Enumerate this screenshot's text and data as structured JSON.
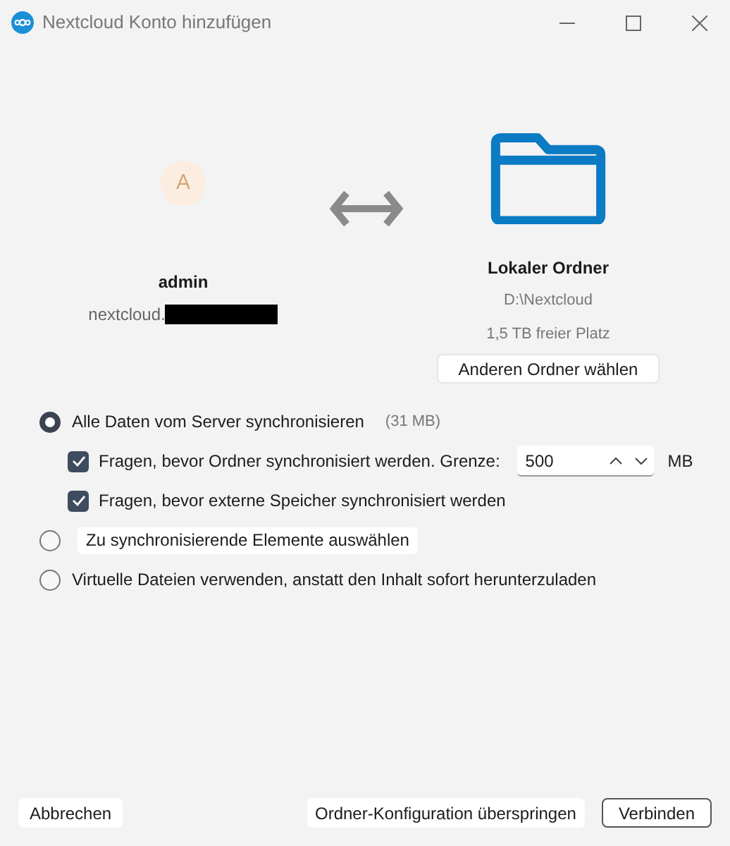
{
  "window": {
    "title": "Nextcloud Konto hinzufügen"
  },
  "account": {
    "avatar_letter": "A",
    "user": "admin",
    "server": "nextcloud.",
    "server_redacted": true
  },
  "local": {
    "title": "Lokaler Ordner",
    "path": "D:\\Nextcloud",
    "free_space": "1,5 TB freier Platz",
    "button": "Anderen Ordner wählen"
  },
  "options": [
    {
      "kind": "radio",
      "label": "Alle Daten vom Server synchronisieren",
      "size": "(31 MB)",
      "selected": true,
      "children": [
        {
          "kind": "limit",
          "label": "Fragen, bevor Ordner synchronisiert werden. Grenze:",
          "checked": true,
          "value": "500",
          "unit": "MB"
        },
        {
          "kind": "check",
          "label": "Fragen, bevor externe Speicher synchronisiert werden",
          "checked": true
        }
      ]
    },
    {
      "kind": "radio-button",
      "label": "Zu synchronisierende Elemente auswählen",
      "selected": false
    },
    {
      "kind": "radio",
      "label": "Virtuelle Dateien verwenden, anstatt den Inhalt sofort herunterzuladen",
      "selected": false
    }
  ],
  "buttons": {
    "cancel": "Abbrechen",
    "skip": "Ordner-Konfiguration überspringen",
    "connect": "Verbinden"
  }
}
